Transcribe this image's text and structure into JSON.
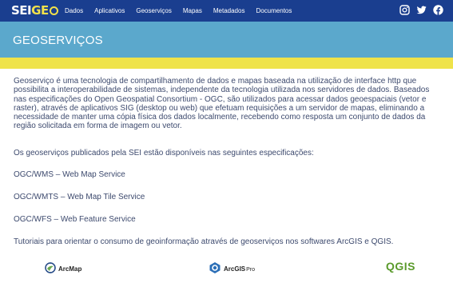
{
  "header": {
    "logo_text_left": "SEI",
    "logo_text_right": "GE",
    "nav": [
      "Dados",
      "Aplicativos",
      "Geoserviços",
      "Mapas",
      "Metadados",
      "Documentos"
    ],
    "social_icons": [
      "instagram-icon",
      "twitter-icon",
      "facebook-icon"
    ]
  },
  "hero": {
    "title": "GEOSERVIÇOS"
  },
  "content": {
    "paragraph1": "Geoserviço é uma tecnologia de compartilhamento de dados e mapas baseada na utilização de interface http que possibilita a interoperabilidade de sistemas, independente da tecnologia utilizada nos servidores de dados. Baseados nas especificações do Open Geospatial Consortium - OGC, são utilizados para acessar dados geoespaciais (vetor e raster), através de aplicativos SIG (desktop ou web) que efetuam requisições a um servidor de mapas, eliminando a necessidade de manter uma cópia física dos dados localmente, recebendo como resposta um conjunto de dados da região solicitada em forma de imagem ou vetor.",
    "paragraph2": "Os geoserviços publicados pela SEI estão disponíveis nas seguintes especificações:",
    "specs": [
      "OGC/WMS – Web Map Service",
      "OGC/WMTS – Web Map Tile Service",
      "OGC/WFS – Web Feature Service"
    ],
    "paragraph3": "Tutoriais para orientar o consumo de geoinformação através de geoserviços nos softwares ArcGIS e QGIS."
  },
  "software_logos": {
    "arcmap": "ArcMap",
    "arcgis_pro_a": "ArcGIS",
    "arcgis_pro_b": "Pro",
    "qgis": "QGIS"
  },
  "colors": {
    "topbar": "#1a3e8f",
    "hero": "#5ba8cc",
    "band": "#efe34a",
    "text": "#3d4a6e"
  }
}
